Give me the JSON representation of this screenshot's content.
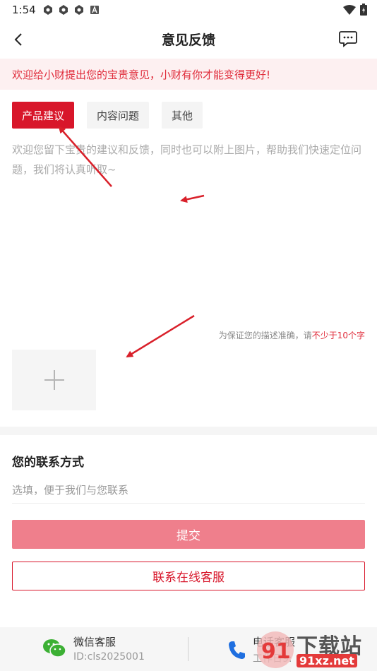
{
  "status_bar": {
    "time": "1:54",
    "icons": [
      "app-notification-icon",
      "app-notification-icon",
      "app-notification-icon",
      "a-notification-icon"
    ],
    "right_icons": [
      "wifi-icon",
      "battery-icon"
    ]
  },
  "header": {
    "title": "意见反馈",
    "back_icon": "chevron-left-icon",
    "message_icon": "chat-bubble-icon"
  },
  "banner": {
    "text": "欢迎给小财提出您的宝贵意见，小财有你才能变得更好!"
  },
  "tabs": [
    {
      "label": "产品建议",
      "active": true
    },
    {
      "label": "内容问题",
      "active": false
    },
    {
      "label": "其他",
      "active": false
    }
  ],
  "feedback": {
    "placeholder": "欢迎您留下宝贵的建议和反馈，同时也可以附上图片，帮助我们快速定位问题，我们将认真听取~",
    "value": ""
  },
  "hint": {
    "prefix": "为保证您的描述准确，请",
    "accent": "不少于10个字"
  },
  "upload": {
    "icon": "plus-icon"
  },
  "contact": {
    "title": "您的联系方式",
    "placeholder": "选填，便于我们与您联系",
    "value": ""
  },
  "buttons": {
    "submit": "提交",
    "online_service": "联系在线客服"
  },
  "footer": {
    "wechat": {
      "title": "微信客服",
      "id": "ID:cls2025001",
      "icon": "wechat-icon"
    },
    "phone": {
      "title": "电话客服",
      "sub": "工作日9:",
      "icon": "phone-icon"
    }
  },
  "watermark": {
    "text": "下载站",
    "url": "91xz.net"
  },
  "colors": {
    "accent": "#d8162a",
    "submit_disabled": "#ef7f8c",
    "banner_bg": "#fdf0f1",
    "annotation_arrow": "#d9202a"
  }
}
